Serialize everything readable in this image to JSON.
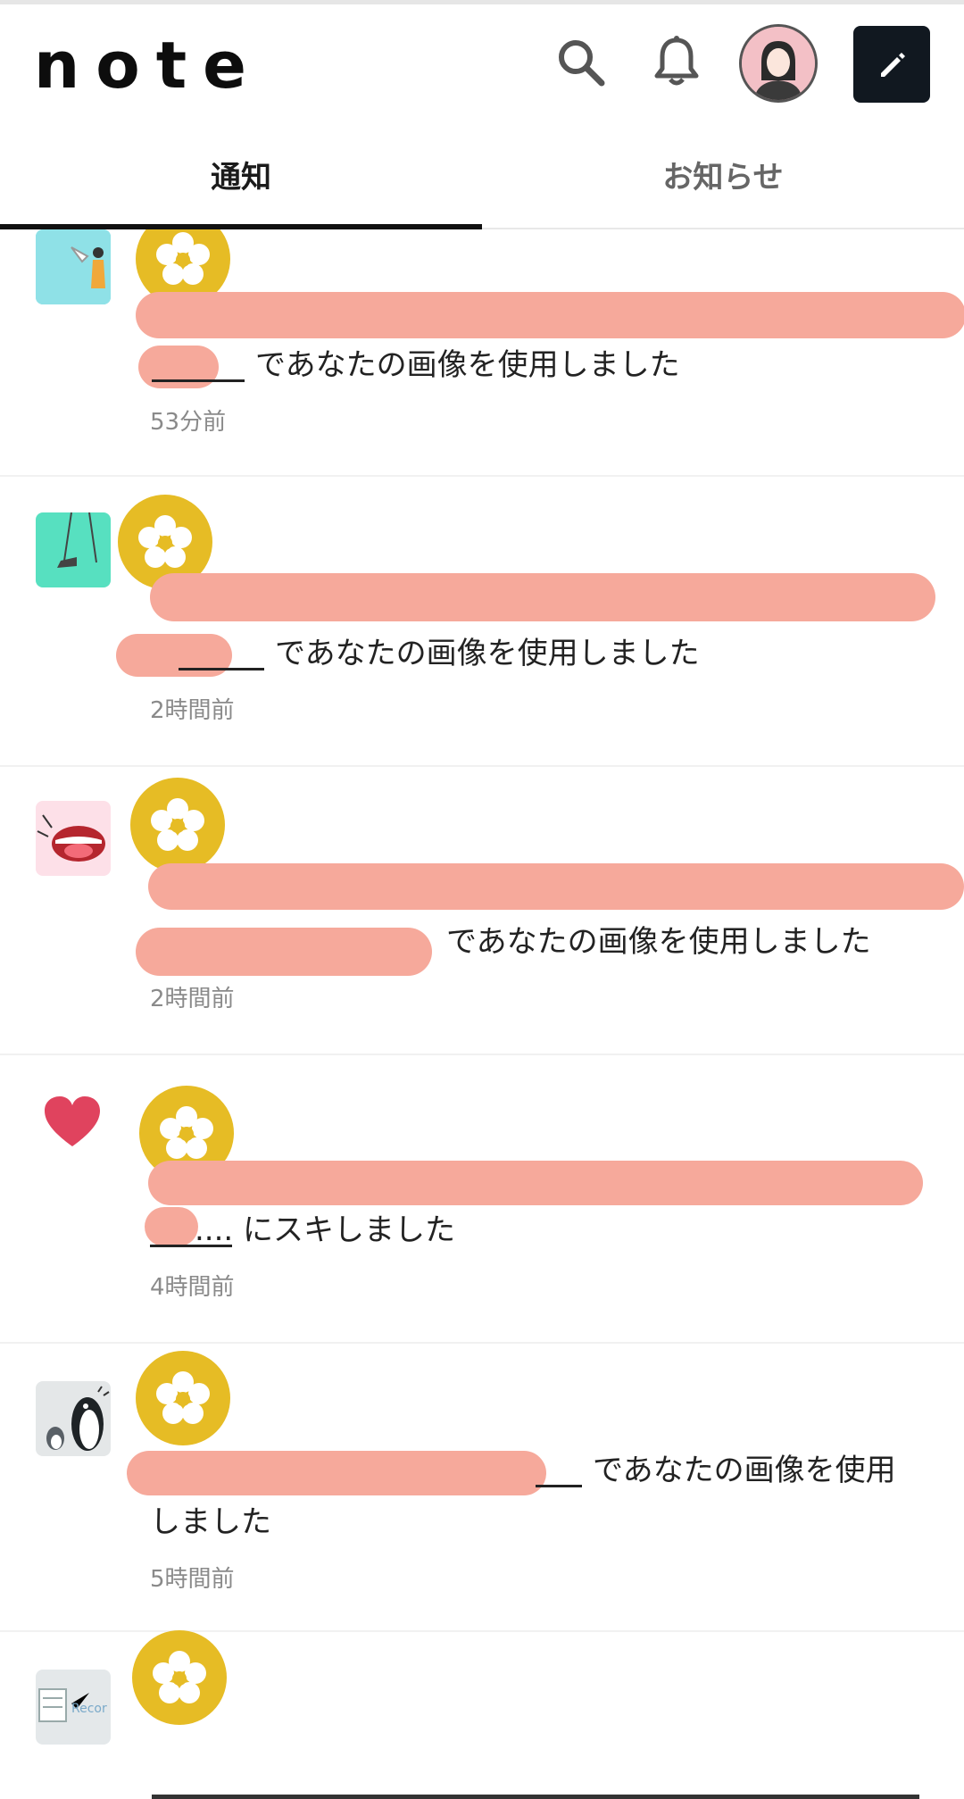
{
  "app": {
    "logo": "note"
  },
  "header": {
    "search_icon": "search-icon",
    "bell_icon": "bell-icon",
    "compose_icon": "pencil-icon"
  },
  "tabs": [
    {
      "label": "通知",
      "active": true
    },
    {
      "label": "お知らせ",
      "active": false
    }
  ],
  "notifications": [
    {
      "text": "であなたの画像を使用しました",
      "time": "53分前",
      "thumb": "megaphone-illustration"
    },
    {
      "text": "であなたの画像を使用しました",
      "time": "2時間前",
      "thumb": "shoe-illustration"
    },
    {
      "text": "であなたの画像を使用しました",
      "time": "2時間前",
      "thumb": "mouth-illustration"
    },
    {
      "prefix": "....",
      "text": "にスキしました",
      "time": "4時間前",
      "thumb": "heart-icon"
    },
    {
      "text": "であなたの画像を使用",
      "text2": "しました",
      "time": "5時間前",
      "thumb": "penguin-illustration"
    },
    {
      "text": "",
      "time": "",
      "thumb": "record-illustration"
    }
  ],
  "colors": {
    "badge": "#e6bc25",
    "redaction": "#f6a99b",
    "heart": "#e0435e",
    "accent": "#111111"
  }
}
